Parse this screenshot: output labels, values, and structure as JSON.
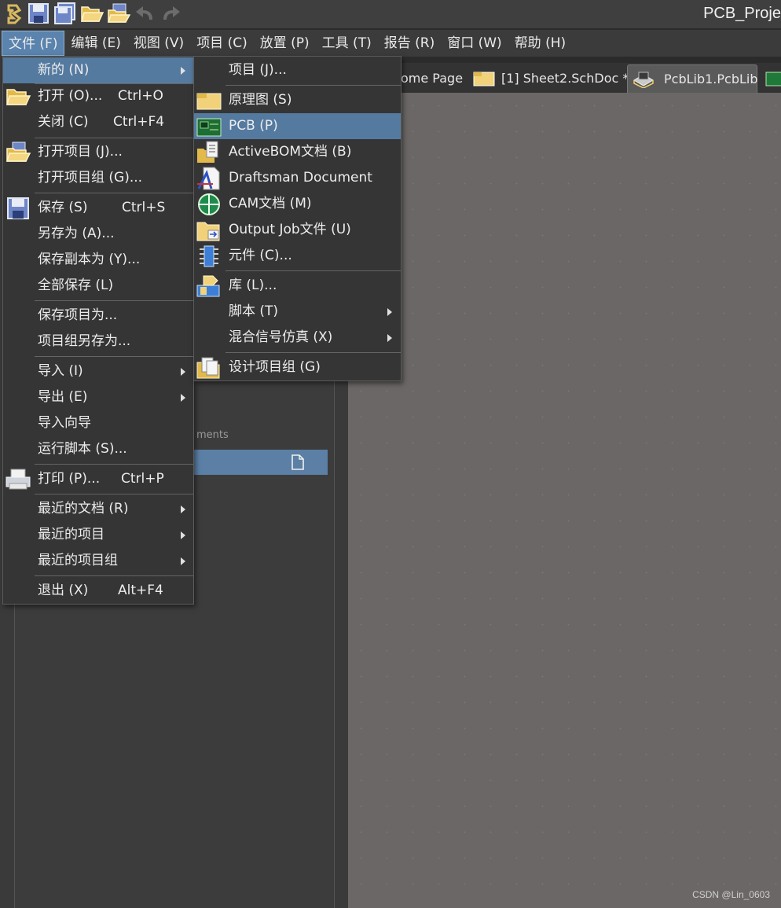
{
  "window": {
    "title": "PCB_Proje"
  },
  "menubar": [
    "文件 (F)",
    "编辑 (E)",
    "视图 (V)",
    "项目 (C)",
    "放置 (P)",
    "工具 (T)",
    "报告 (R)",
    "窗口 (W)",
    "帮助 (H)"
  ],
  "tabs": [
    {
      "label": "ome Page"
    },
    {
      "label": "[1] Sheet2.SchDoc *"
    },
    {
      "label": "PcbLib1.PcbLib"
    }
  ],
  "panel": {
    "partial_text": "ments"
  },
  "file_menu": [
    {
      "label": "新的 (N)",
      "shortcut": "",
      "submenu": true
    },
    {
      "label": "打开 (O)...",
      "shortcut": "Ctrl+O",
      "icon": "open-folder-icon"
    },
    {
      "label": "关闭 (C)",
      "shortcut": "Ctrl+F4"
    },
    {
      "label": "打开项目 (J)...",
      "shortcut": "",
      "icon": "open-project-icon"
    },
    {
      "label": "打开项目组 (G)...",
      "shortcut": ""
    },
    {
      "label": "保存 (S)",
      "shortcut": "Ctrl+S",
      "icon": "save-icon"
    },
    {
      "label": "另存为 (A)...",
      "shortcut": ""
    },
    {
      "label": "保存副本为 (Y)...",
      "shortcut": ""
    },
    {
      "label": "全部保存 (L)",
      "shortcut": ""
    },
    {
      "label": "保存项目为...",
      "shortcut": ""
    },
    {
      "label": "项目组另存为...",
      "shortcut": ""
    },
    {
      "label": "导入 (I)",
      "shortcut": "",
      "submenu": true
    },
    {
      "label": "导出 (E)",
      "shortcut": "",
      "submenu": true
    },
    {
      "label": "导入向导",
      "shortcut": ""
    },
    {
      "label": "运行脚本 (S)...",
      "shortcut": ""
    },
    {
      "label": "打印 (P)...",
      "shortcut": "Ctrl+P",
      "icon": "printer-icon"
    },
    {
      "label": "最近的文档 (R)",
      "shortcut": "",
      "submenu": true
    },
    {
      "label": "最近的项目",
      "shortcut": "",
      "submenu": true
    },
    {
      "label": "最近的项目组",
      "shortcut": "",
      "submenu": true
    },
    {
      "label": "退出 (X)",
      "shortcut": "Alt+F4"
    }
  ],
  "new_submenu": [
    {
      "label": "项目 (J)..."
    },
    {
      "label": "原理图 (S)",
      "icon": "schematic-icon"
    },
    {
      "label": "PCB (P)",
      "icon": "pcb-icon"
    },
    {
      "label": "ActiveBOM文档 (B)",
      "icon": "bom-icon"
    },
    {
      "label": "Draftsman Document",
      "icon": "draftsman-icon"
    },
    {
      "label": "CAM文档 (M)",
      "icon": "cam-icon"
    },
    {
      "label": "Output Job文件 (U)",
      "icon": "outjob-icon"
    },
    {
      "label": "元件 (C)...",
      "icon": "component-icon"
    },
    {
      "label": "库 (L)...",
      "icon": "library-icon"
    },
    {
      "label": "脚本 (T)",
      "submenu": true
    },
    {
      "label": "混合信号仿真 (X)",
      "submenu": true
    },
    {
      "label": "设计项目组 (G)",
      "icon": "project-group-icon"
    }
  ],
  "watermark": "CSDN @Lin_0603",
  "colors": {
    "highlight": "#557aa0",
    "menu_bg": "#353535",
    "canvas": "#6b6766"
  }
}
